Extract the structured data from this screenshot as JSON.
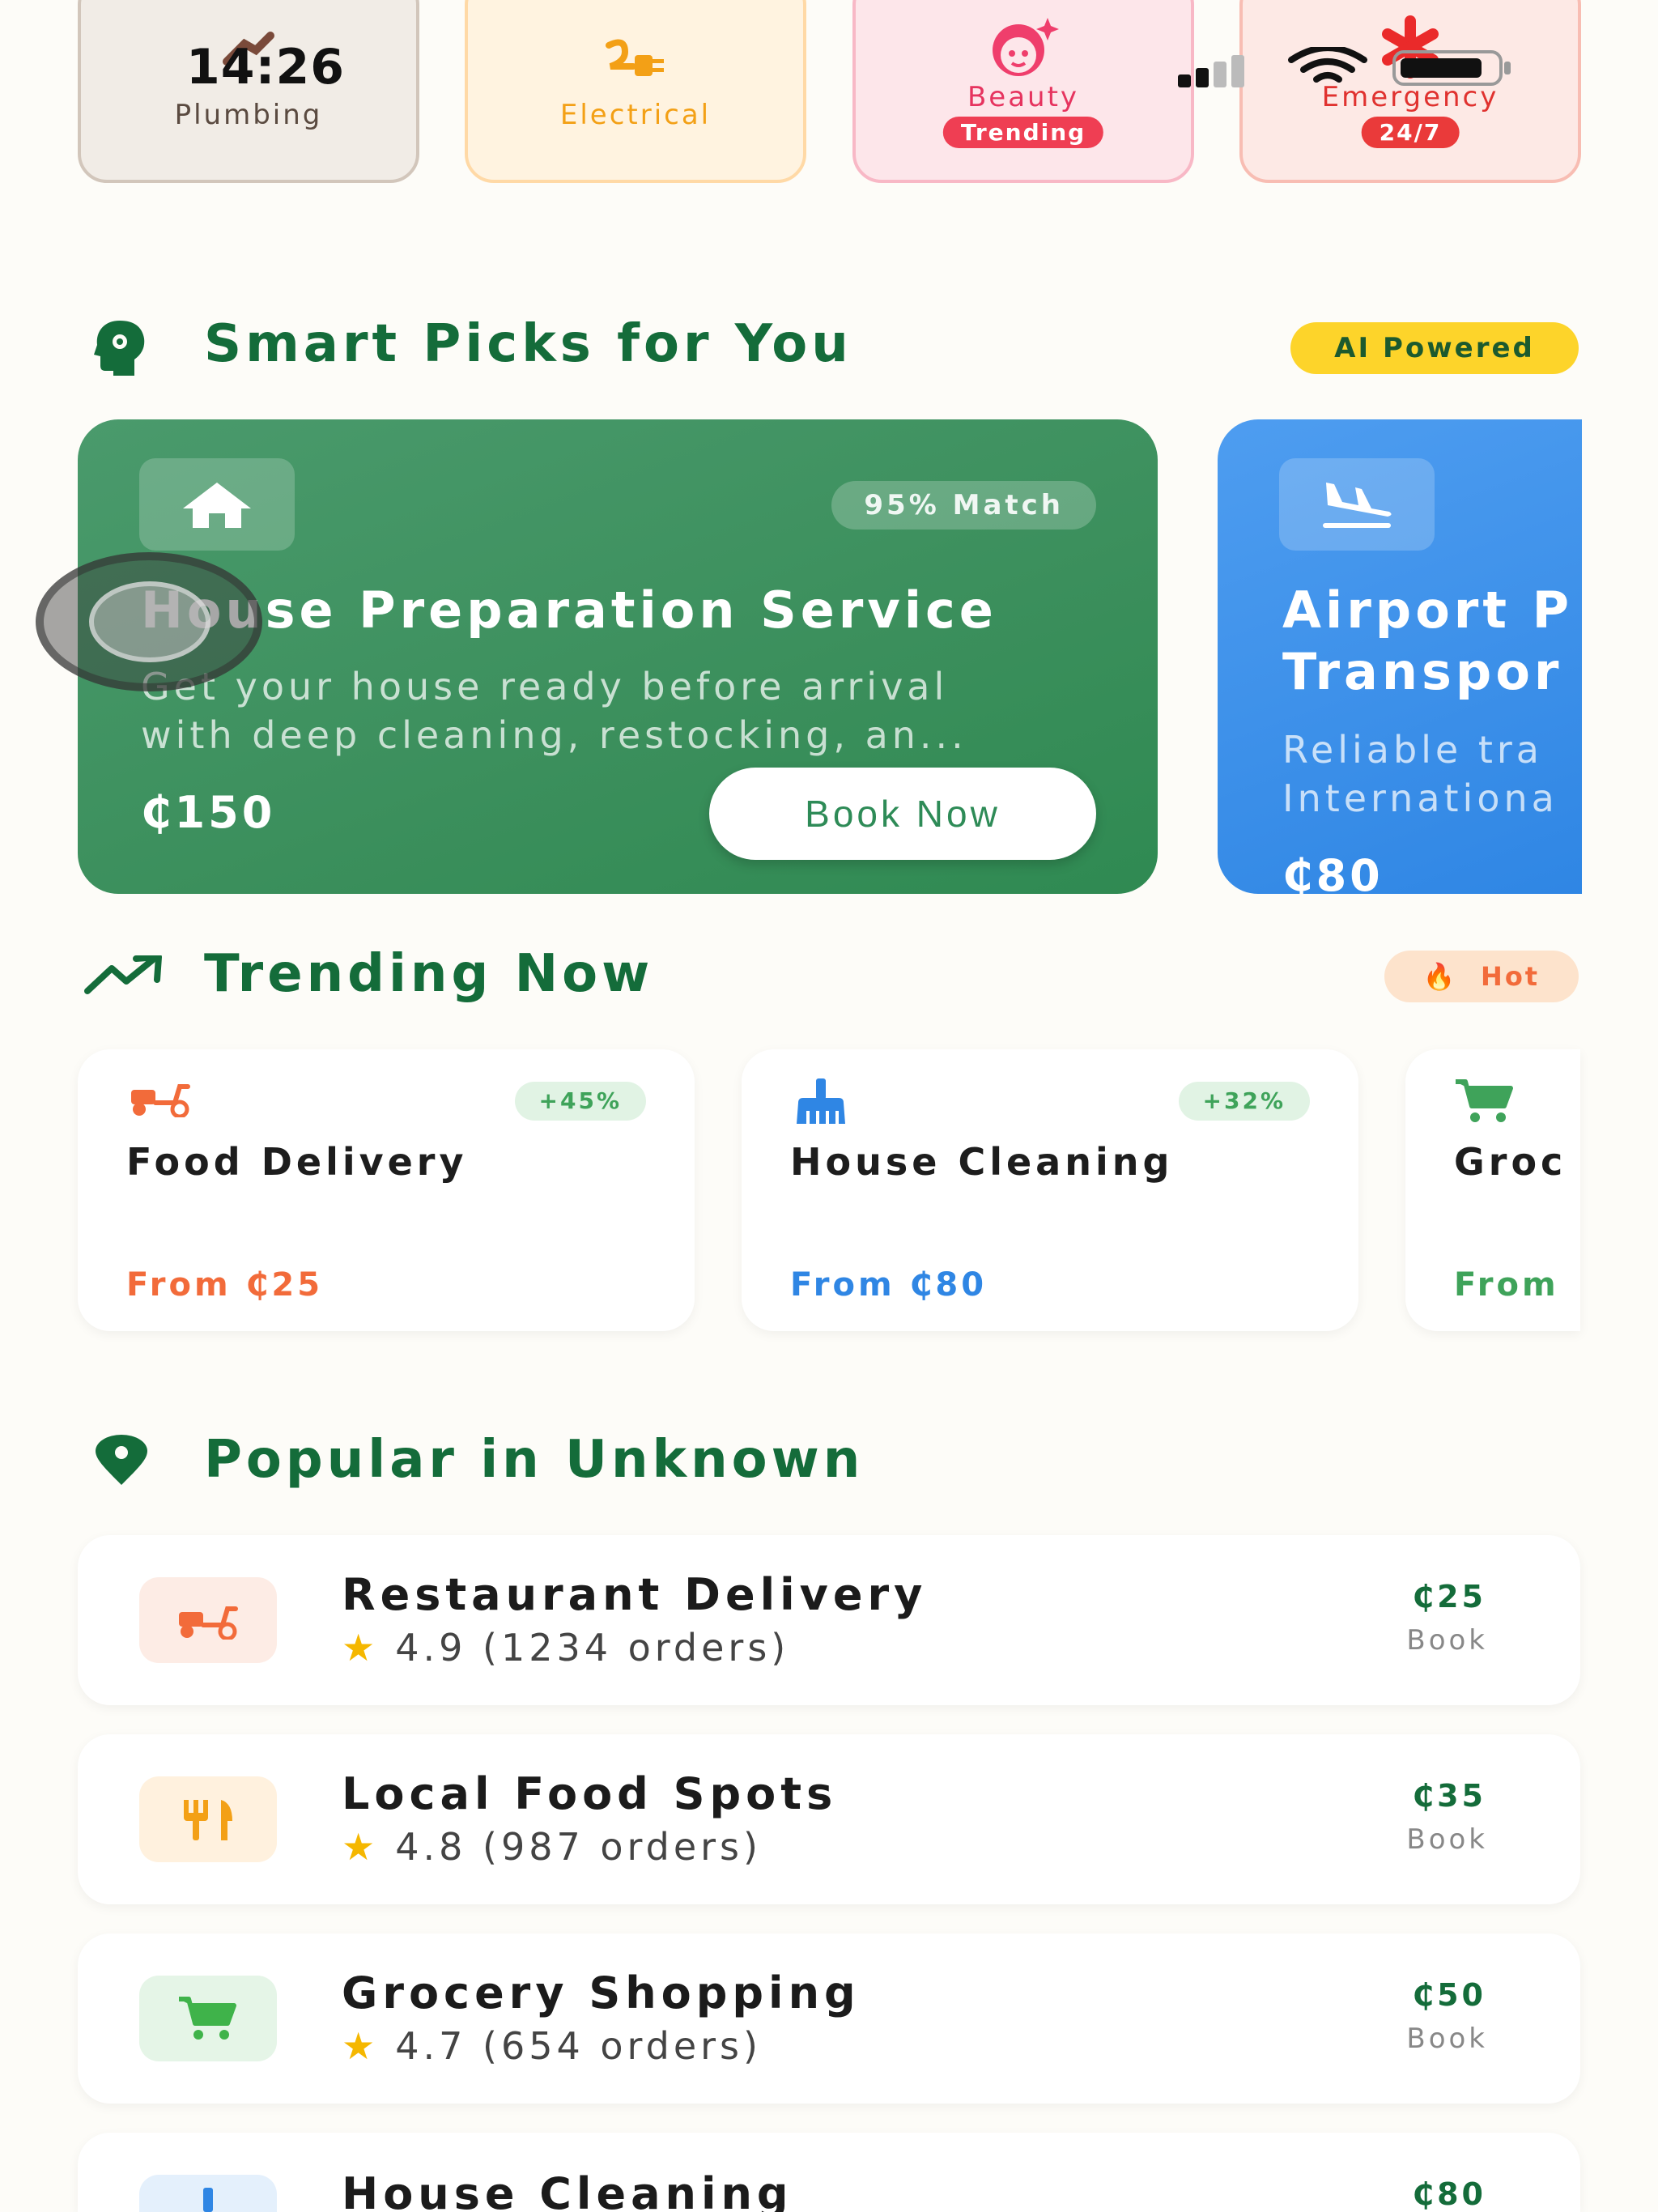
{
  "status_bar": {
    "time": "14:26"
  },
  "categories": [
    {
      "label": "Plumbing",
      "badge": ""
    },
    {
      "label": "Electrical",
      "badge": ""
    },
    {
      "label": "Beauty",
      "badge": "Trending"
    },
    {
      "label": "Emergency",
      "badge": "24/7"
    }
  ],
  "smart_picks": {
    "title": "Smart Picks for You",
    "badge": "AI Powered",
    "cards": [
      {
        "title": "House Preparation Service",
        "desc_line1": "Get your house ready before arrival",
        "desc_line2": "with deep cleaning, restocking, an...",
        "match": "95% Match",
        "price": "₵150",
        "cta": "Book Now",
        "icon": "home-icon"
      },
      {
        "title_line1": "Airport P",
        "title_line2": "Transpor",
        "desc_line1": "Reliable tra",
        "desc_line2": "Internationa",
        "price": "₵80",
        "icon": "airplane-landing-icon"
      }
    ]
  },
  "trending": {
    "title": "Trending Now",
    "badge": "Hot",
    "badge_icon": "🔥",
    "cards": [
      {
        "title": "Food Delivery",
        "pct": "+45%",
        "from": "From ₵25",
        "color": "#f26b3a"
      },
      {
        "title": "House Cleaning",
        "pct": "+32%",
        "from": "From ₵80",
        "color": "#2f86e4"
      },
      {
        "title": "Groc",
        "from": "From",
        "color": "#3fa35a"
      }
    ]
  },
  "popular": {
    "title": "Popular in Unknown",
    "items": [
      {
        "name": "Restaurant Delivery",
        "rating": "4.9 (1234 orders)",
        "price": "₵25",
        "action": "Book",
        "star": "★"
      },
      {
        "name": "Local Food Spots",
        "rating": "4.8 (987 orders)",
        "price": "₵35",
        "action": "Book",
        "star": "★"
      },
      {
        "name": "Grocery Shopping",
        "rating": "4.7 (654 orders)",
        "price": "₵50",
        "action": "Book",
        "star": "★"
      },
      {
        "name": "House Cleaning",
        "price": "₵80"
      }
    ]
  },
  "colors": {
    "brand_green": "#146c3a",
    "accent_yellow": "#fdd42a",
    "hot_orange": "#f26b3a"
  }
}
